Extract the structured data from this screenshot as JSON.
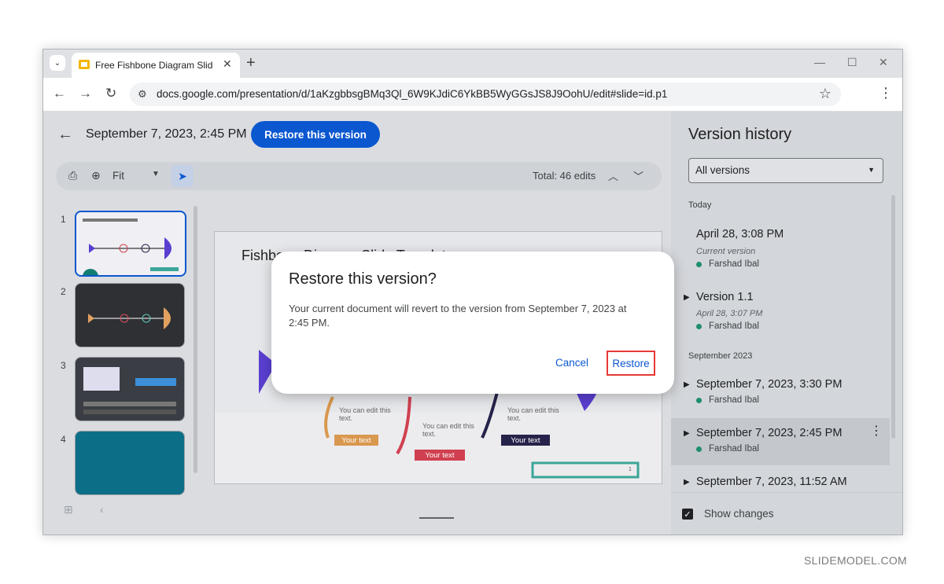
{
  "browser": {
    "tab_title": "Free Fishbone Diagram Slide Te",
    "url": "docs.google.com/presentation/d/1aKzgbbsgBMq3Ql_6W9KJdiC6YkBB5WyGGsJS8J9OohU/edit#slide=id.p1"
  },
  "header": {
    "date": "September 7, 2023, 2:45 PM",
    "restore_button": "Restore this version"
  },
  "viewbar": {
    "zoom": "Fit",
    "total": "Total: 46 edits"
  },
  "filmstrip": {
    "slide_numbers": [
      "1",
      "2",
      "3",
      "4"
    ]
  },
  "slide": {
    "title": "Fishbone Diagram Slide Template",
    "captions": [
      "You can edit this text.",
      "You can edit this text.",
      "You can edit this text."
    ],
    "pills": [
      "Your text",
      "Your text",
      "Your text"
    ],
    "page_number": "1"
  },
  "version_history": {
    "title": "Version history",
    "filter": "All versions",
    "sections": {
      "today": "Today",
      "september": "September 2023"
    },
    "entries": [
      {
        "title": "April 28, 3:08 PM",
        "sub": "Current version",
        "author": "Farshad Ibal"
      },
      {
        "title": "Version 1.1",
        "sub": "April 28, 3:07 PM",
        "author": "Farshad Ibal"
      },
      {
        "title": "September 7, 2023, 3:30 PM",
        "author": "Farshad Ibal"
      },
      {
        "title": "September 7, 2023, 2:45 PM",
        "author": "Farshad Ibal"
      },
      {
        "title": "September 7, 2023, 11:52 AM"
      }
    ],
    "show_changes": "Show changes"
  },
  "modal": {
    "title": "Restore this version?",
    "body": "Your current document will revert to the version from September 7, 2023 at 2:45 PM.",
    "cancel": "Cancel",
    "restore": "Restore"
  },
  "watermark": "SLIDEMODEL.COM",
  "colors": {
    "accent": "#0b57d0",
    "highlight_border": "#e53935",
    "author_dot": "#1e8e6e"
  }
}
